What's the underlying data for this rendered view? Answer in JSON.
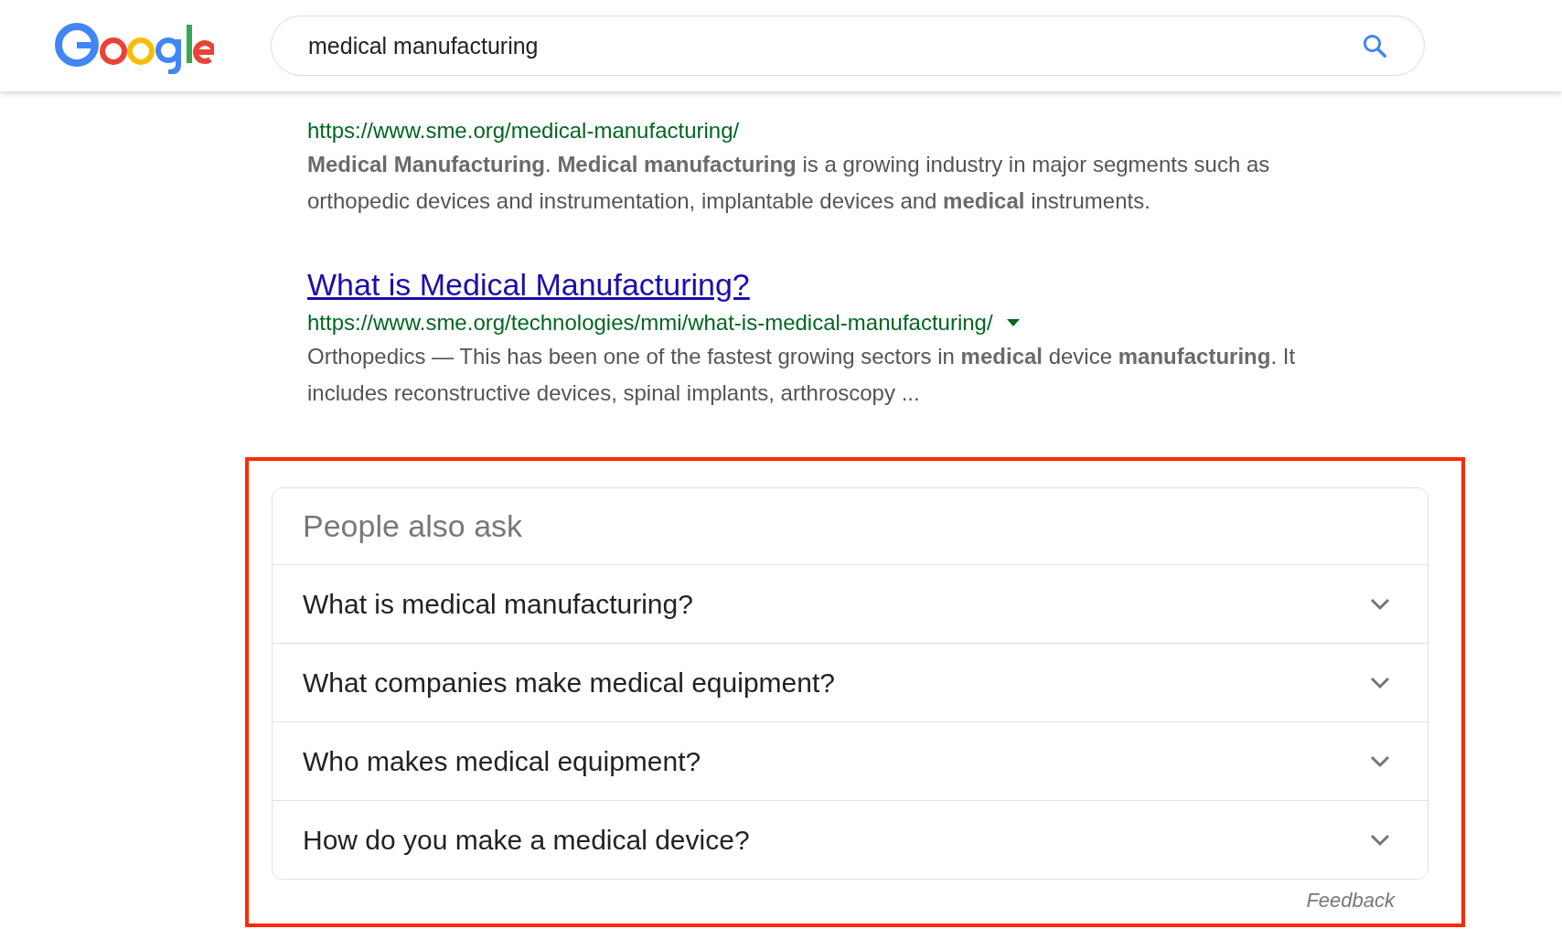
{
  "search": {
    "query": "medical manufacturing"
  },
  "results": [
    {
      "url": "https://www.sme.org/medical-manufacturing/",
      "has_menu": false,
      "snippet": "**Medical Manufacturing**. **Medical manufacturing** is a growing industry in major segments such as orthopedic devices and instrumentation, implantable devices and **medical** instruments."
    },
    {
      "title": "What is Medical Manufacturing?",
      "url": "https://www.sme.org/technologies/mmi/what-is-medical-manufacturing/",
      "has_menu": true,
      "snippet": "Orthopedics — This has been one of the fastest growing sectors in **medical** device **manufacturing**. It includes reconstructive devices, spinal implants, arthroscopy ..."
    }
  ],
  "people_also_ask": {
    "heading": "People also ask",
    "questions": [
      {
        "text": "What is medical manufacturing?",
        "expanded": false
      },
      {
        "text": "What companies make medical equipment?",
        "expanded": false
      },
      {
        "text": "Who makes medical equipment?",
        "expanded": false
      },
      {
        "text": "How do you make a medical device?",
        "expanded": false
      }
    ],
    "feedback": "Feedback"
  }
}
